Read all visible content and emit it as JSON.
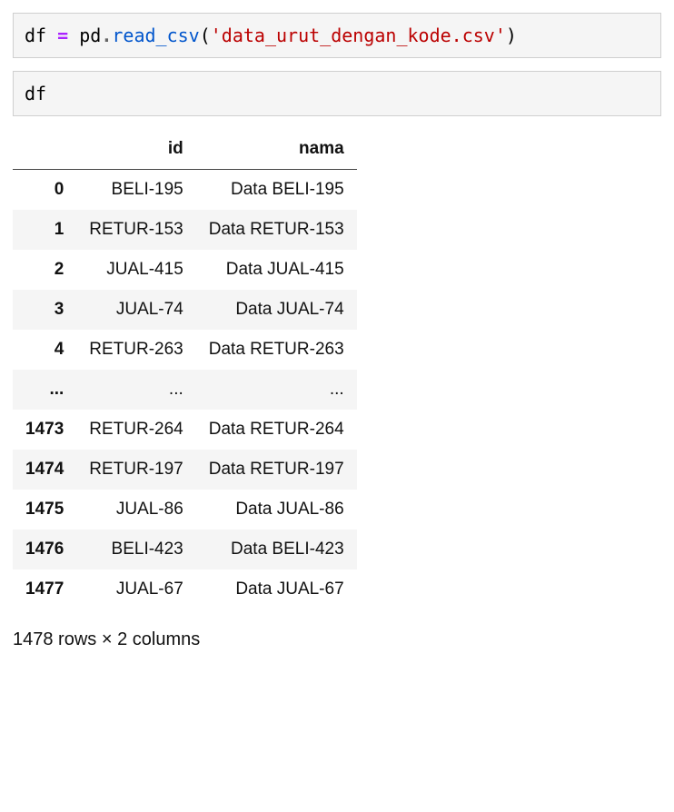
{
  "code_cell_1": {
    "var": "df",
    "space1": " ",
    "op": "=",
    "space2": " ",
    "mod": "pd",
    "dot": ".",
    "func": "read_csv",
    "lparen": "(",
    "str": "'data_urut_dengan_kode.csv'",
    "rparen": ")"
  },
  "code_cell_2": {
    "code": "df"
  },
  "table": {
    "columns": [
      "id",
      "nama"
    ],
    "rows": [
      {
        "idx": "0",
        "id": "BELI-195",
        "nama": "Data BELI-195"
      },
      {
        "idx": "1",
        "id": "RETUR-153",
        "nama": "Data RETUR-153"
      },
      {
        "idx": "2",
        "id": "JUAL-415",
        "nama": "Data JUAL-415"
      },
      {
        "idx": "3",
        "id": "JUAL-74",
        "nama": "Data JUAL-74"
      },
      {
        "idx": "4",
        "id": "RETUR-263",
        "nama": "Data RETUR-263"
      },
      {
        "idx": "...",
        "id": "...",
        "nama": "..."
      },
      {
        "idx": "1473",
        "id": "RETUR-264",
        "nama": "Data RETUR-264"
      },
      {
        "idx": "1474",
        "id": "RETUR-197",
        "nama": "Data RETUR-197"
      },
      {
        "idx": "1475",
        "id": "JUAL-86",
        "nama": "Data JUAL-86"
      },
      {
        "idx": "1476",
        "id": "BELI-423",
        "nama": "Data BELI-423"
      },
      {
        "idx": "1477",
        "id": "JUAL-67",
        "nama": "Data JUAL-67"
      }
    ]
  },
  "summary": "1478 rows × 2 columns"
}
